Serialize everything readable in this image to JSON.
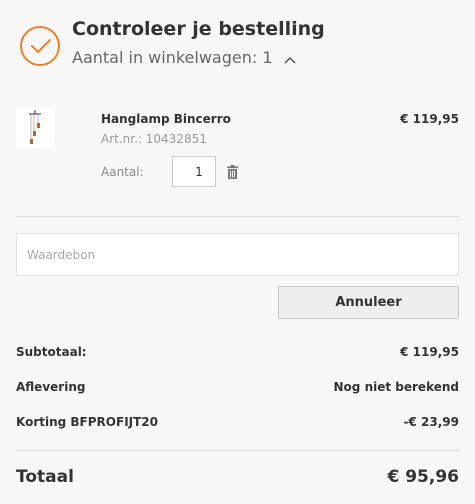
{
  "header": {
    "title": "Controleer je bestelling",
    "subtitle": "Aantal in winkelwagen: 1",
    "accent_color": "#ee7f2d",
    "status_icon": "check-circle-icon",
    "toggle_icon": "chevron-up-icon"
  },
  "product": {
    "name": "Hanglamp Bincerro",
    "article": "Art.nr.: 10432851",
    "price": "€ 119,95",
    "qty_label": "Aantal:",
    "qty_value": "1",
    "delete_icon": "trash-icon"
  },
  "voucher": {
    "placeholder": "Waardebon",
    "cancel_label": "Annuleer"
  },
  "summary": {
    "subtotal_label": "Subtotaal:",
    "subtotal_value": "€ 119,95",
    "delivery_label": "Aflevering",
    "delivery_value": "Nog niet berekend",
    "discount_label": "Korting BFPROFIJT20",
    "discount_value": "-€ 23,99",
    "total_label": "Totaal",
    "total_value": "€ 95,96"
  }
}
